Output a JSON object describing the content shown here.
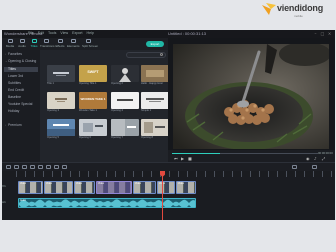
{
  "watermark": {
    "brand": "viendidong",
    "tagline": "mobile"
  },
  "window": {
    "app_title": "Wondershare Filmora",
    "project_title": "Untitled : 00:00:31:13",
    "menu": [
      "File",
      "Edit",
      "Tools",
      "View",
      "Export",
      "Help"
    ]
  },
  "toolbar": {
    "tabs": [
      {
        "label": "Media",
        "icon": "media-icon"
      },
      {
        "label": "Audio",
        "icon": "audio-icon"
      },
      {
        "label": "Titles",
        "icon": "titles-icon"
      },
      {
        "label": "Transitions",
        "icon": "transitions-icon"
      },
      {
        "label": "Effects",
        "icon": "effects-icon"
      },
      {
        "label": "Elements",
        "icon": "elements-icon"
      },
      {
        "label": "Split Screen",
        "icon": "split-screen-icon"
      }
    ],
    "active_tab": "Titles",
    "export_label": "Export"
  },
  "sidebar": {
    "items": [
      {
        "label": "Favorites"
      },
      {
        "label": "Opening & Closing",
        "selected": true
      },
      {
        "label": "Titles"
      },
      {
        "label": "Lower 3rd"
      },
      {
        "label": "Subtitles"
      },
      {
        "label": "End Credit"
      },
      {
        "label": "Baseline"
      },
      {
        "label": "Youtube Special"
      },
      {
        "label": "Holiday"
      },
      {
        "label": "Premium"
      }
    ]
  },
  "browser": {
    "search_placeholder": "Search",
    "thumbnails": [
      {
        "caption": "Title 1",
        "text": "",
        "bg": "#3a3f47"
      },
      {
        "caption": "Opening Title 1",
        "text": "SWIFT",
        "bg": "#c4a24a"
      },
      {
        "caption": "Opening 2",
        "text": "",
        "bg": "#2c2f35"
      },
      {
        "caption": "Hello · Happy Hour",
        "text": "",
        "bg": "#6a5a48"
      },
      {
        "caption": "Opening 3",
        "text": "",
        "bg": "#d9d3c6"
      },
      {
        "caption": "Wooden Take 1",
        "text": "WOODEN TAKE 1",
        "bg": "#b07a3a"
      },
      {
        "caption": "Opening 4",
        "text": "",
        "bg": "#f2f2f2"
      },
      {
        "caption": "Simple 1",
        "text": "",
        "bg": "#ececec"
      },
      {
        "caption": "Opening 5",
        "text": "",
        "bg": "#5f87b1"
      },
      {
        "caption": "Opening 6",
        "text": "",
        "bg": "#c8cdd2"
      },
      {
        "caption": "Opening 7",
        "text": "",
        "bg": "#9aa2a8"
      },
      {
        "caption": "Opening 8",
        "text": "",
        "bg": "#d7d2c8"
      }
    ]
  },
  "preview": {
    "timecode": "00:00:00:00",
    "progress": 0.33,
    "controls": [
      "previous-icon",
      "play-icon",
      "stop-icon"
    ]
  },
  "timeline": {
    "track_labels": [
      "V1",
      "A1"
    ],
    "clips": [
      {
        "caption": "Video"
      },
      {
        "caption": "Video"
      },
      {
        "caption": "Video"
      },
      {
        "caption": "Video"
      },
      {
        "caption": "Video"
      },
      {
        "caption": "Video"
      },
      {
        "caption": "Video"
      }
    ],
    "audio_clip": "Audio"
  }
}
